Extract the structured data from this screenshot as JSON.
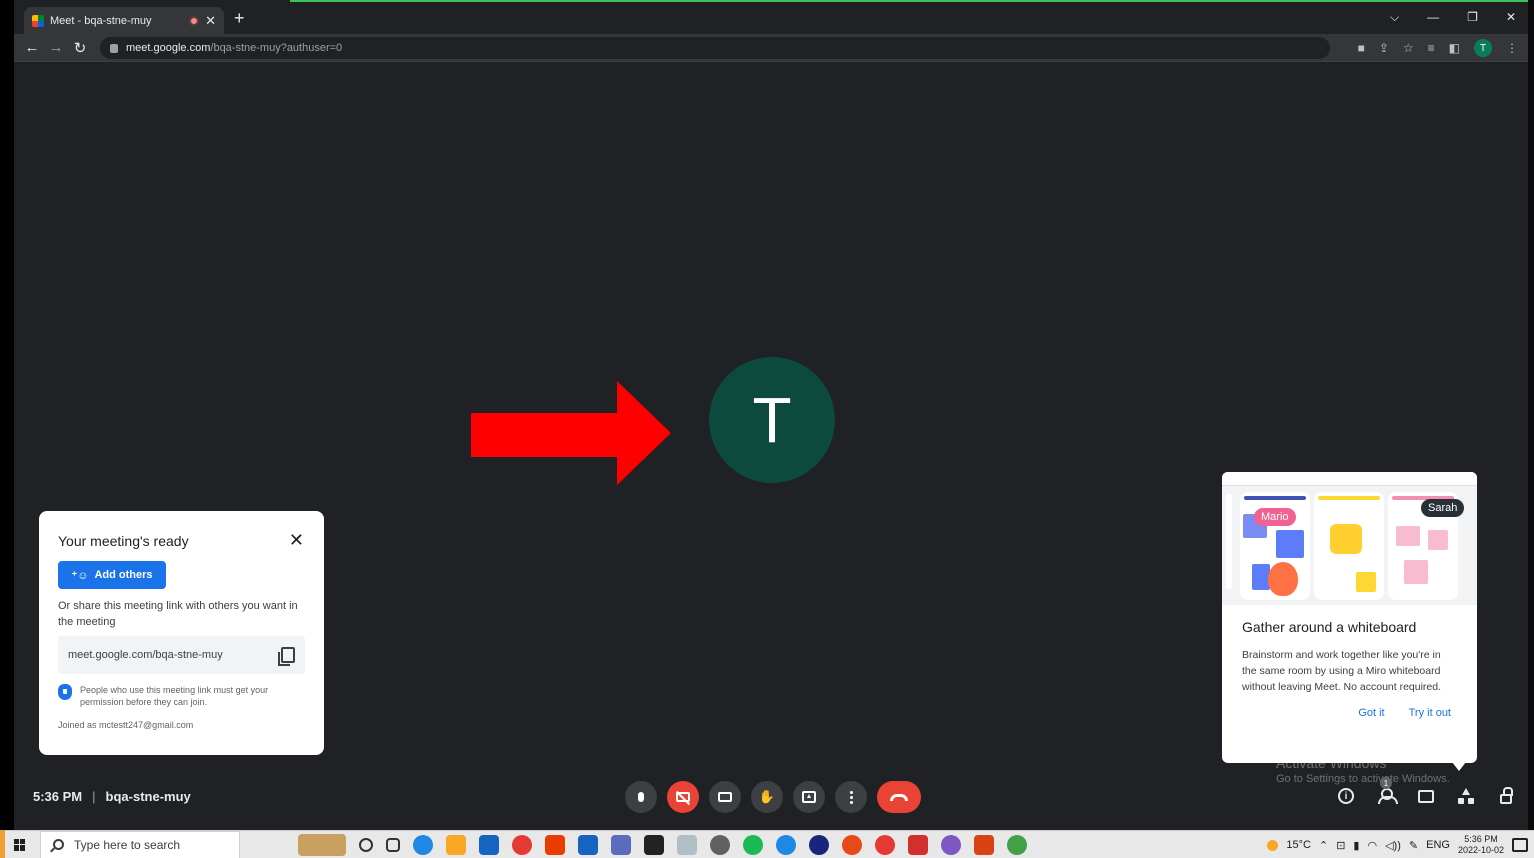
{
  "browser": {
    "tab_title": "Meet - bqa-stne-muy",
    "url_host": "meet.google.com",
    "url_path": "/bqa-stne-muy?authuser=0",
    "profile_initial": "T"
  },
  "meeting": {
    "participant_initial": "T",
    "time": "5:36 PM",
    "separator": "|",
    "code": "bqa-stne-muy",
    "participants_badge": "1"
  },
  "ready_card": {
    "title": "Your meeting's ready",
    "add_others_label": "Add others",
    "share_text": "Or share this meeting link with others you want in the meeting",
    "meeting_link": "meet.google.com/bqa-stne-muy",
    "permission_note": "People who use this meeting link must get your permission before they can join.",
    "joined_as": "Joined as mctestt247@gmail.com"
  },
  "whiteboard_card": {
    "tag_mario": "Mario",
    "tag_sarah": "Sarah",
    "title": "Gather around a whiteboard",
    "description": "Brainstorm and work together like you're in the same room by using a Miro whiteboard without leaving Meet. No account required.",
    "got_it_label": "Got it",
    "try_it_out_label": "Try it out"
  },
  "watermark": {
    "line1": "Activate Windows",
    "line2": "Go to Settings to activate Windows."
  },
  "taskbar": {
    "search_placeholder": "Type here to search",
    "weather": "15°C",
    "language": "ENG",
    "time": "5:36 PM",
    "date": "2022-10-02"
  },
  "colors": {
    "meet_bg": "#202124",
    "avatar_bg": "#0b4a3c",
    "primary_blue": "#1a73e8",
    "end_call_red": "#ea4335",
    "annotation_arrow": "#ff0000"
  }
}
